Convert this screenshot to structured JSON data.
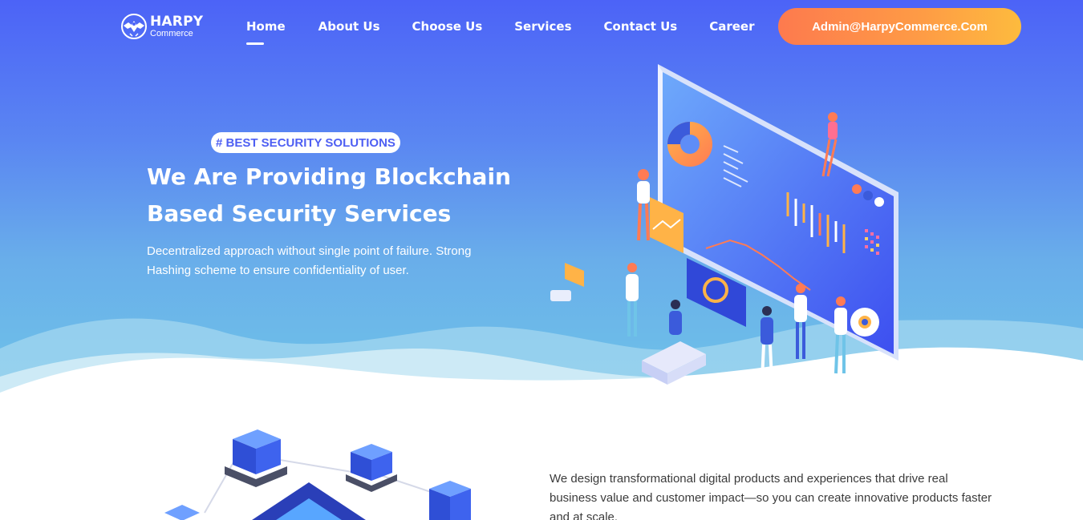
{
  "logo": {
    "title": "HARPY",
    "subtitle": "Commerce"
  },
  "nav": {
    "items": [
      {
        "label": "Home",
        "active": true
      },
      {
        "label": "About Us",
        "active": false
      },
      {
        "label": "Choose Us",
        "active": false
      },
      {
        "label": "Services",
        "active": false
      },
      {
        "label": "Contact Us",
        "active": false
      },
      {
        "label": "Career",
        "active": false
      }
    ],
    "cta_label": "Admin@HarpyCommerce.Com"
  },
  "hero": {
    "badge": "# BEST SECURITY SOLUTIONS",
    "headline": "We Are Providing Blockchain Based Security Services",
    "description": "Decentralized approach without single point of failure. Strong Hashing scheme to ensure confidentiality of user.",
    "illustration_icon": "blockchain-dashboard-illustration"
  },
  "about": {
    "text": "We design transformational digital products and experiences that drive real business value and customer impact—so you can create innovative products faster and at scale.",
    "illustration_icon": "network-servers-illustration"
  },
  "colors": {
    "hero_gradient_top": "#4c63f7",
    "hero_gradient_bottom": "#6fc4e8",
    "cta_start": "#fd7a4e",
    "cta_end": "#fdbb3e",
    "badge_text": "#4e5ff3"
  }
}
